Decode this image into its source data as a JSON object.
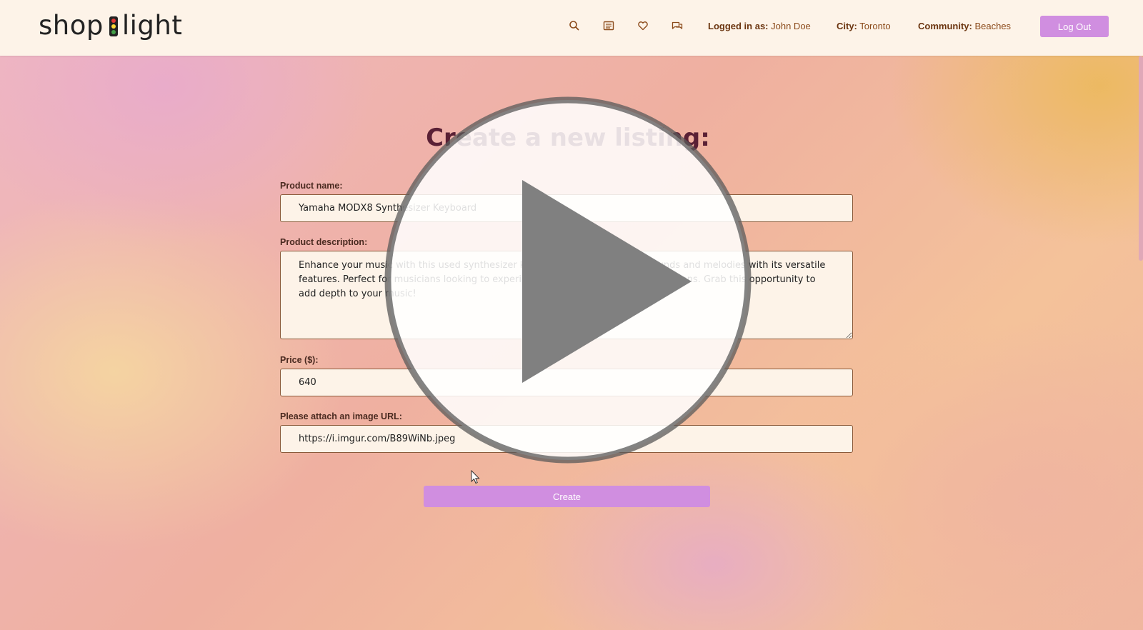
{
  "brand": {
    "logo_left": "shop",
    "logo_right": "light"
  },
  "nav": {
    "icons": [
      "search-icon",
      "listings-icon",
      "heart-icon",
      "chat-icon"
    ],
    "logged_in_label": "Logged in as:",
    "logged_in_value": "John Doe",
    "city_label": "City:",
    "city_value": "Toronto",
    "community_label": "Community:",
    "community_value": "Beaches",
    "logout_label": "Log Out"
  },
  "form": {
    "title": "Create a new listing:",
    "name_label": "Product name:",
    "name_value": "Yamaha MODX8 Synthesizer Keyboard",
    "description_label": "Product description:",
    "description_value": "Enhance your music with this used synthesizer keyboard. Explore creative sounds and melodies with its versatile features. Perfect for musicians looking to experiment and create unique compositions. Grab this opportunity to add depth to your music!",
    "price_label": "Price ($):",
    "price_value": "640",
    "image_label": "Please attach an image URL:",
    "image_value": "https://i.imgur.com/B89WiNb.jpeg",
    "create_label": "Create"
  },
  "colors": {
    "accent": "#d08ee0",
    "navbar_bg": "#fdf3e8",
    "nav_text": "#8b4a1a",
    "field_bg": "#fdf3e8"
  },
  "overlay": {
    "icon": "play-icon"
  }
}
